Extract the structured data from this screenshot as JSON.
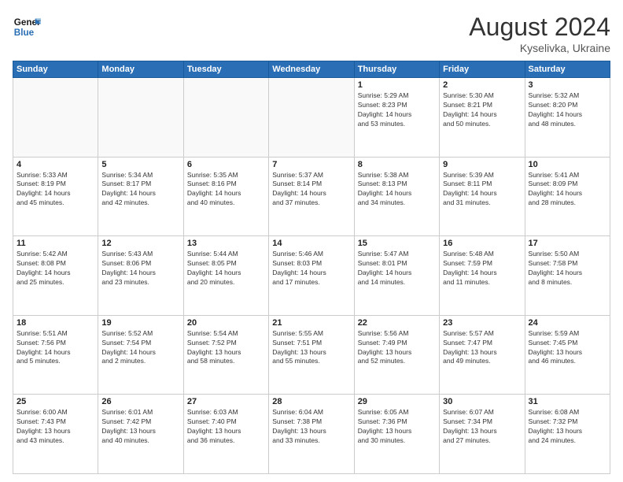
{
  "header": {
    "logo_line1": "General",
    "logo_line2": "Blue",
    "month": "August 2024",
    "location": "Kyselivka, Ukraine"
  },
  "weekdays": [
    "Sunday",
    "Monday",
    "Tuesday",
    "Wednesday",
    "Thursday",
    "Friday",
    "Saturday"
  ],
  "weeks": [
    [
      {
        "day": "",
        "info": ""
      },
      {
        "day": "",
        "info": ""
      },
      {
        "day": "",
        "info": ""
      },
      {
        "day": "",
        "info": ""
      },
      {
        "day": "1",
        "info": "Sunrise: 5:29 AM\nSunset: 8:23 PM\nDaylight: 14 hours\nand 53 minutes."
      },
      {
        "day": "2",
        "info": "Sunrise: 5:30 AM\nSunset: 8:21 PM\nDaylight: 14 hours\nand 50 minutes."
      },
      {
        "day": "3",
        "info": "Sunrise: 5:32 AM\nSunset: 8:20 PM\nDaylight: 14 hours\nand 48 minutes."
      }
    ],
    [
      {
        "day": "4",
        "info": "Sunrise: 5:33 AM\nSunset: 8:19 PM\nDaylight: 14 hours\nand 45 minutes."
      },
      {
        "day": "5",
        "info": "Sunrise: 5:34 AM\nSunset: 8:17 PM\nDaylight: 14 hours\nand 42 minutes."
      },
      {
        "day": "6",
        "info": "Sunrise: 5:35 AM\nSunset: 8:16 PM\nDaylight: 14 hours\nand 40 minutes."
      },
      {
        "day": "7",
        "info": "Sunrise: 5:37 AM\nSunset: 8:14 PM\nDaylight: 14 hours\nand 37 minutes."
      },
      {
        "day": "8",
        "info": "Sunrise: 5:38 AM\nSunset: 8:13 PM\nDaylight: 14 hours\nand 34 minutes."
      },
      {
        "day": "9",
        "info": "Sunrise: 5:39 AM\nSunset: 8:11 PM\nDaylight: 14 hours\nand 31 minutes."
      },
      {
        "day": "10",
        "info": "Sunrise: 5:41 AM\nSunset: 8:09 PM\nDaylight: 14 hours\nand 28 minutes."
      }
    ],
    [
      {
        "day": "11",
        "info": "Sunrise: 5:42 AM\nSunset: 8:08 PM\nDaylight: 14 hours\nand 25 minutes."
      },
      {
        "day": "12",
        "info": "Sunrise: 5:43 AM\nSunset: 8:06 PM\nDaylight: 14 hours\nand 23 minutes."
      },
      {
        "day": "13",
        "info": "Sunrise: 5:44 AM\nSunset: 8:05 PM\nDaylight: 14 hours\nand 20 minutes."
      },
      {
        "day": "14",
        "info": "Sunrise: 5:46 AM\nSunset: 8:03 PM\nDaylight: 14 hours\nand 17 minutes."
      },
      {
        "day": "15",
        "info": "Sunrise: 5:47 AM\nSunset: 8:01 PM\nDaylight: 14 hours\nand 14 minutes."
      },
      {
        "day": "16",
        "info": "Sunrise: 5:48 AM\nSunset: 7:59 PM\nDaylight: 14 hours\nand 11 minutes."
      },
      {
        "day": "17",
        "info": "Sunrise: 5:50 AM\nSunset: 7:58 PM\nDaylight: 14 hours\nand 8 minutes."
      }
    ],
    [
      {
        "day": "18",
        "info": "Sunrise: 5:51 AM\nSunset: 7:56 PM\nDaylight: 14 hours\nand 5 minutes."
      },
      {
        "day": "19",
        "info": "Sunrise: 5:52 AM\nSunset: 7:54 PM\nDaylight: 14 hours\nand 2 minutes."
      },
      {
        "day": "20",
        "info": "Sunrise: 5:54 AM\nSunset: 7:52 PM\nDaylight: 13 hours\nand 58 minutes."
      },
      {
        "day": "21",
        "info": "Sunrise: 5:55 AM\nSunset: 7:51 PM\nDaylight: 13 hours\nand 55 minutes."
      },
      {
        "day": "22",
        "info": "Sunrise: 5:56 AM\nSunset: 7:49 PM\nDaylight: 13 hours\nand 52 minutes."
      },
      {
        "day": "23",
        "info": "Sunrise: 5:57 AM\nSunset: 7:47 PM\nDaylight: 13 hours\nand 49 minutes."
      },
      {
        "day": "24",
        "info": "Sunrise: 5:59 AM\nSunset: 7:45 PM\nDaylight: 13 hours\nand 46 minutes."
      }
    ],
    [
      {
        "day": "25",
        "info": "Sunrise: 6:00 AM\nSunset: 7:43 PM\nDaylight: 13 hours\nand 43 minutes."
      },
      {
        "day": "26",
        "info": "Sunrise: 6:01 AM\nSunset: 7:42 PM\nDaylight: 13 hours\nand 40 minutes."
      },
      {
        "day": "27",
        "info": "Sunrise: 6:03 AM\nSunset: 7:40 PM\nDaylight: 13 hours\nand 36 minutes."
      },
      {
        "day": "28",
        "info": "Sunrise: 6:04 AM\nSunset: 7:38 PM\nDaylight: 13 hours\nand 33 minutes."
      },
      {
        "day": "29",
        "info": "Sunrise: 6:05 AM\nSunset: 7:36 PM\nDaylight: 13 hours\nand 30 minutes."
      },
      {
        "day": "30",
        "info": "Sunrise: 6:07 AM\nSunset: 7:34 PM\nDaylight: 13 hours\nand 27 minutes."
      },
      {
        "day": "31",
        "info": "Sunrise: 6:08 AM\nSunset: 7:32 PM\nDaylight: 13 hours\nand 24 minutes."
      }
    ]
  ]
}
